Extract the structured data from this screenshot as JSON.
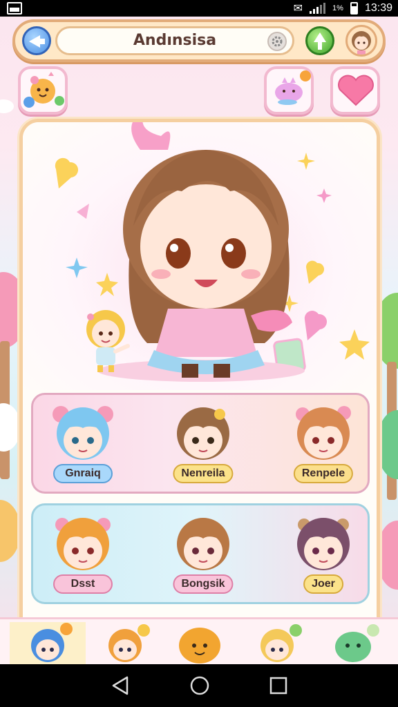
{
  "status_bar": {
    "time": "13:39",
    "battery_text": "1%"
  },
  "header": {
    "character_name": "Andınsisa"
  },
  "roster_row_1": [
    {
      "name": "Gnraiq",
      "hair": "#7ec7f0",
      "pill": "#a9d8fb",
      "pill_border": "#5a9fd8"
    },
    {
      "name": "Nenreila",
      "hair": "#9a6a44",
      "pill": "#fbe28a",
      "pill_border": "#d7a93b"
    },
    {
      "name": "Renpele",
      "hair": "#d98a52",
      "pill": "#fbdf8c",
      "pill_border": "#d7a93b"
    }
  ],
  "roster_row_2": [
    {
      "name": "Dsst",
      "hair": "#f0a03c",
      "pill": "#f9c4da",
      "pill_border": "#de7ea6"
    },
    {
      "name": "Bongsik",
      "hair": "#b97845",
      "pill": "#f9c4da",
      "pill_border": "#de7ea6"
    },
    {
      "name": "Joer",
      "hair": "#7b4f6a",
      "pill": "#fbe28a",
      "pill_border": "#d7a93b"
    }
  ],
  "dock": [
    {
      "hair": "#4a8ee0",
      "active": true
    },
    {
      "hair": "#f0a03c",
      "active": false
    },
    {
      "hair": "#f2a530",
      "active": false
    },
    {
      "hair": "#f4c95a",
      "active": false
    },
    {
      "hair": "#6cc98a",
      "active": false
    }
  ],
  "colors": {
    "accent_pink": "#f7a8c4",
    "frame_orange": "#f5cfa0"
  }
}
